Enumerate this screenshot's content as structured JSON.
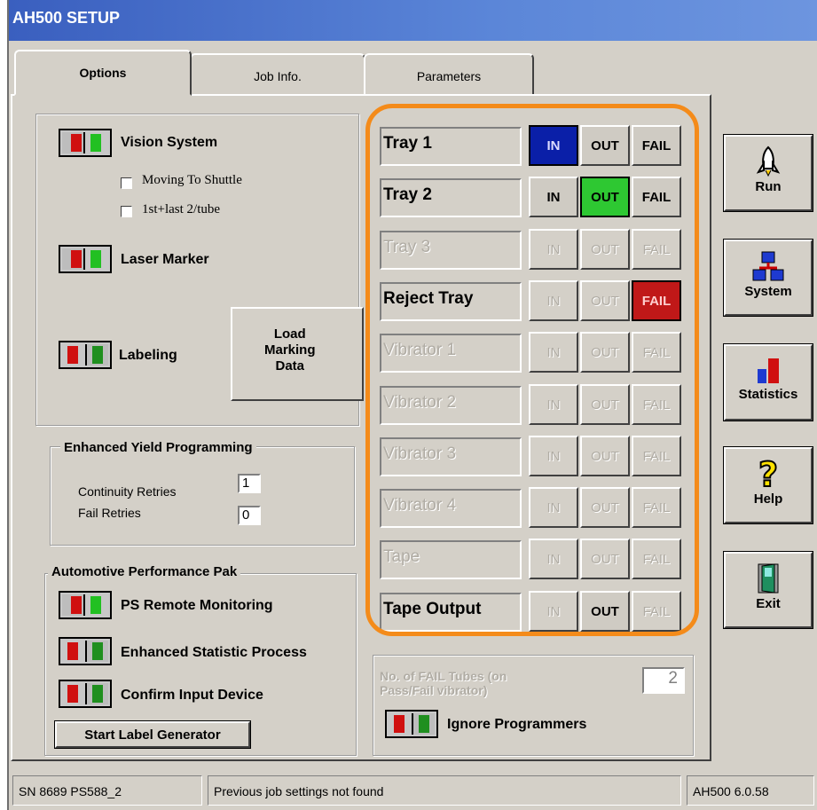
{
  "window": {
    "title": "AH500 SETUP"
  },
  "tabs": [
    {
      "label": "Options",
      "active": true
    },
    {
      "label": "Job Info."
    },
    {
      "label": "Parameters"
    }
  ],
  "options": {
    "vision_system": {
      "label": "Vision System",
      "state": "on"
    },
    "checkboxes": [
      {
        "label": "Moving To Shuttle",
        "checked": false
      },
      {
        "label": "1st+last 2/tube",
        "checked": false
      }
    ],
    "laser_marker": {
      "label": "Laser Marker",
      "state": "on"
    },
    "labeling": {
      "label": "Labeling",
      "state": "off"
    },
    "load_marking_data": [
      "Load",
      "Marking",
      "Data"
    ],
    "enhanced_yield": {
      "title": "Enhanced Yield Programming",
      "continuity_retries_label": "Continuity Retries",
      "continuity_retries_value": "1",
      "fail_retries_label": "Fail Retries",
      "fail_retries_value": "0"
    },
    "automotive": {
      "title": "Automotive Performance Pak",
      "items": [
        {
          "label": "PS Remote Monitoring",
          "state": "on"
        },
        {
          "label": "Enhanced Statistic Process",
          "state": "off"
        },
        {
          "label": "Confirm Input Device",
          "state": "off"
        }
      ]
    },
    "start_label_generator": "Start Label Generator"
  },
  "trays": [
    {
      "name": "Tray 1",
      "enabled": true,
      "in": "IN",
      "out": "OUT",
      "fail": "FAIL",
      "selected": "in"
    },
    {
      "name": "Tray 2",
      "enabled": true,
      "in": "IN",
      "out": "OUT",
      "fail": "FAIL",
      "selected": "out"
    },
    {
      "name": "Tray 3",
      "enabled": false,
      "in": "IN",
      "out": "OUT",
      "fail": "FAIL",
      "selected": ""
    },
    {
      "name": "Reject Tray",
      "enabled": true,
      "in": "IN",
      "out": "OUT",
      "fail": "FAIL",
      "selected": "fail"
    },
    {
      "name": "Vibrator 1",
      "enabled": false,
      "in": "IN",
      "out": "OUT",
      "fail": "FAIL",
      "selected": ""
    },
    {
      "name": "Vibrator 2",
      "enabled": false,
      "in": "IN",
      "out": "OUT",
      "fail": "FAIL",
      "selected": ""
    },
    {
      "name": "Vibrator 3",
      "enabled": false,
      "in": "IN",
      "out": "OUT",
      "fail": "FAIL",
      "selected": ""
    },
    {
      "name": "Vibrator 4",
      "enabled": false,
      "in": "IN",
      "out": "OUT",
      "fail": "FAIL",
      "selected": ""
    },
    {
      "name": "Tape",
      "enabled": false,
      "in": "IN",
      "out": "OUT",
      "fail": "FAIL",
      "selected": ""
    },
    {
      "name": "Tape Output",
      "enabled": true,
      "in": "IN",
      "out": "OUT",
      "fail": "FAIL",
      "selected": "out-only"
    }
  ],
  "fail_tubes": {
    "label_line1": "No. of FAIL Tubes  (on",
    "label_line2": "Pass/Fail vibrator)",
    "value": "2"
  },
  "ignore_programmers": {
    "label": "Ignore Programmers",
    "state": "off"
  },
  "side_buttons": [
    {
      "label": "Run",
      "icon": "rocket-icon"
    },
    {
      "label": "System",
      "icon": "network-icon"
    },
    {
      "label": "Statistics",
      "icon": "bar-chart-icon"
    },
    {
      "label": "Help",
      "icon": "question-icon"
    },
    {
      "label": "Exit",
      "icon": "door-exit-icon"
    }
  ],
  "status": {
    "serial": "SN 8689  PS588_2",
    "message": "Previous job settings not found",
    "version": "AH500 6.0.58"
  },
  "colors": {
    "highlight": "#f48b1a",
    "in_selected": "#0a1fa8",
    "out_selected": "#2ec832",
    "fail_selected": "#c01818"
  }
}
